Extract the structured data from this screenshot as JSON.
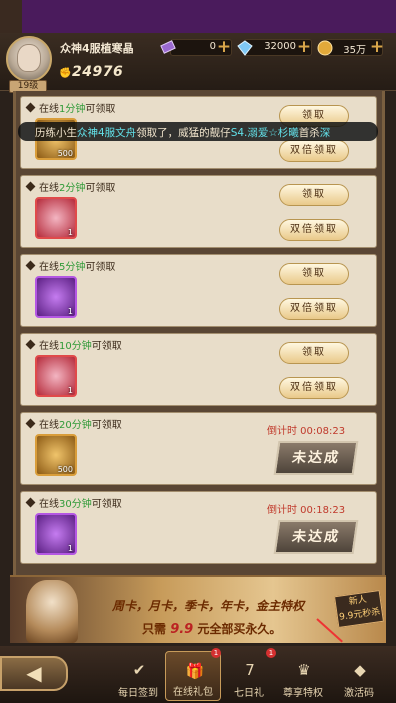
{
  "header": {
    "player_name": "众神4服植寒晶",
    "level": "19级",
    "power": "24976",
    "resources": [
      {
        "icon": "ticket-icon",
        "value": "0"
      },
      {
        "icon": "diamond-icon",
        "value": "32000"
      },
      {
        "icon": "gold-coin-icon",
        "value": "35万"
      }
    ],
    "plus_label": "+"
  },
  "feed": {
    "prefix": "历练小生",
    "name1": "众神4服文舟",
    "middle": "领取了，威猛的靓仔",
    "name2": "S4.溺爱☆杉曦",
    "suffix": "首杀",
    "tail": "深"
  },
  "rewards": [
    {
      "prefix": "在线",
      "num": "1分钟",
      "suffix": "可领取",
      "icon": "treasure-bag-icon",
      "count": "500",
      "state": "claimable"
    },
    {
      "prefix": "在线",
      "num": "2分钟",
      "suffix": "可领取",
      "icon": "gift-card-icon",
      "count": "1",
      "state": "claimable"
    },
    {
      "prefix": "在线",
      "num": "5分钟",
      "suffix": "可领取",
      "icon": "hero-portrait-icon",
      "count": "1",
      "state": "claimable"
    },
    {
      "prefix": "在线",
      "num": "10分钟",
      "suffix": "可领取",
      "icon": "item-pouch-icon",
      "count": "1",
      "state": "claimable"
    },
    {
      "prefix": "在线",
      "num": "20分钟",
      "suffix": "可领取",
      "icon": "treasure-bag-icon",
      "count": "500",
      "state": "locked",
      "timer": "倒计时 00:08:23"
    },
    {
      "prefix": "在线",
      "num": "30分钟",
      "suffix": "可领取",
      "icon": "armor-chest-icon",
      "count": "1",
      "state": "locked",
      "timer": "倒计时 00:18:23"
    }
  ],
  "buttons": {
    "claim": "领取",
    "double_claim": "双倍领取",
    "not_reached": "未达成"
  },
  "banner": {
    "line1": "周卡，月卡，季卡，年卡，金主特权",
    "line2_prefix": "只需",
    "price": "9.9",
    "line2_suffix": "元全部买永久。",
    "badge_top": "新人",
    "badge_bottom": "9.9元秒杀"
  },
  "nav": [
    {
      "label": "每日签到",
      "icon": "calendar-check-icon",
      "badge": ""
    },
    {
      "label": "在线礼包",
      "icon": "gift-box-icon",
      "badge": "1"
    },
    {
      "label": "七日礼",
      "icon": "calendar-seven-icon",
      "badge": "1"
    },
    {
      "label": "尊享特权",
      "icon": "crown-privilege-icon",
      "badge": ""
    },
    {
      "label": "激活码",
      "icon": "activation-code-icon",
      "badge": ""
    }
  ],
  "back_label": "◀",
  "calendar_day": "7"
}
